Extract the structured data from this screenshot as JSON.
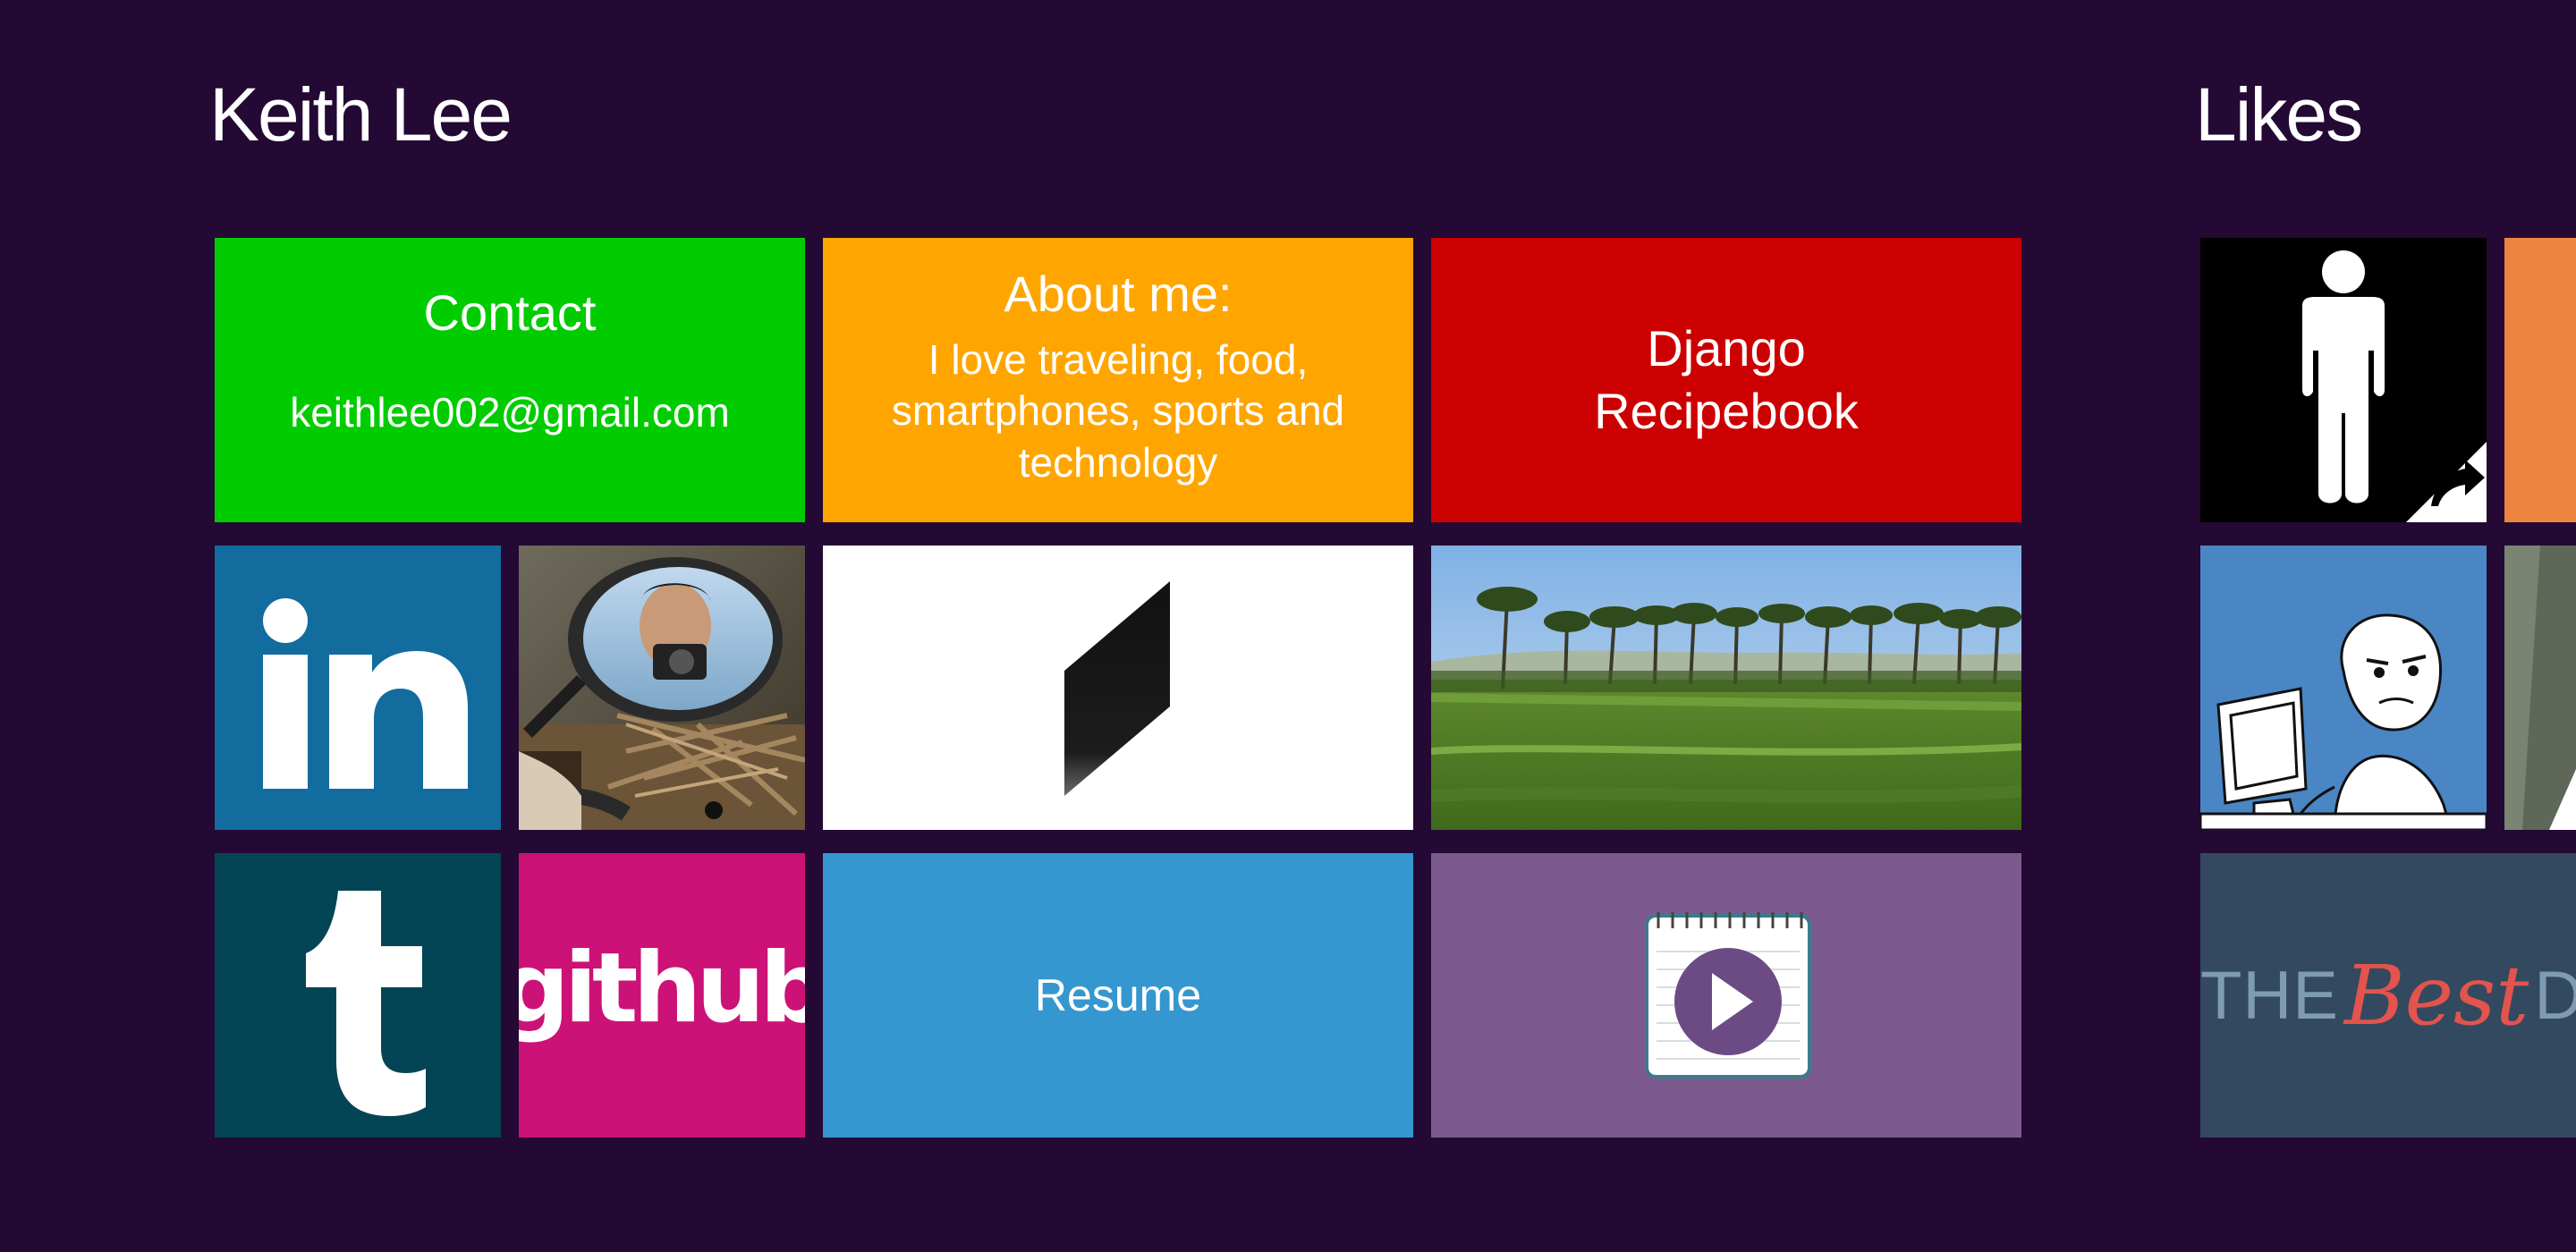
{
  "owner_title": "Keith Lee",
  "likes_title": "Likes",
  "colors": {
    "background": "#230933",
    "contact": "#00cc00",
    "about": "#ffa500",
    "django": "#cc0000",
    "linkedin": "#126c9e",
    "tumblr": "#034555",
    "github": "#cc1177",
    "resume": "#3597cf",
    "video": "#7c5a8e"
  },
  "tiles": {
    "contact": {
      "heading": "Contact",
      "email": "keithlee002@gmail.com"
    },
    "about": {
      "heading": "About me:",
      "text": "I love traveling, food, smartphones, sports and technology"
    },
    "django": {
      "line1": "Django",
      "line2": "Recipebook"
    },
    "linkedin": {
      "logo_text": "in",
      "icon": "linkedin-icon"
    },
    "photo_mirror": {
      "icon": "photo-mirror-selfie"
    },
    "logo": {
      "icon": "slash-logo-icon"
    },
    "landscape": {
      "icon": "palm-trees-field-photo"
    },
    "tumblr": {
      "logo_text": "t",
      "icon": "tumblr-icon"
    },
    "github": {
      "logo_text": "github",
      "icon": "github-icon"
    },
    "resume": {
      "label": "Resume"
    },
    "video": {
      "icon": "video-notepad-play-icon"
    }
  },
  "likes": {
    "item1": {
      "icon": "person-restroom-icon"
    },
    "item2": {
      "icon": "orange-tile"
    },
    "item3": {
      "icon": "meme-computer-guy-icon"
    },
    "item4": {
      "icon": "grey-photo-tile"
    },
    "item5": {
      "the": "THE",
      "best": "Best",
      "de": "DE"
    }
  }
}
